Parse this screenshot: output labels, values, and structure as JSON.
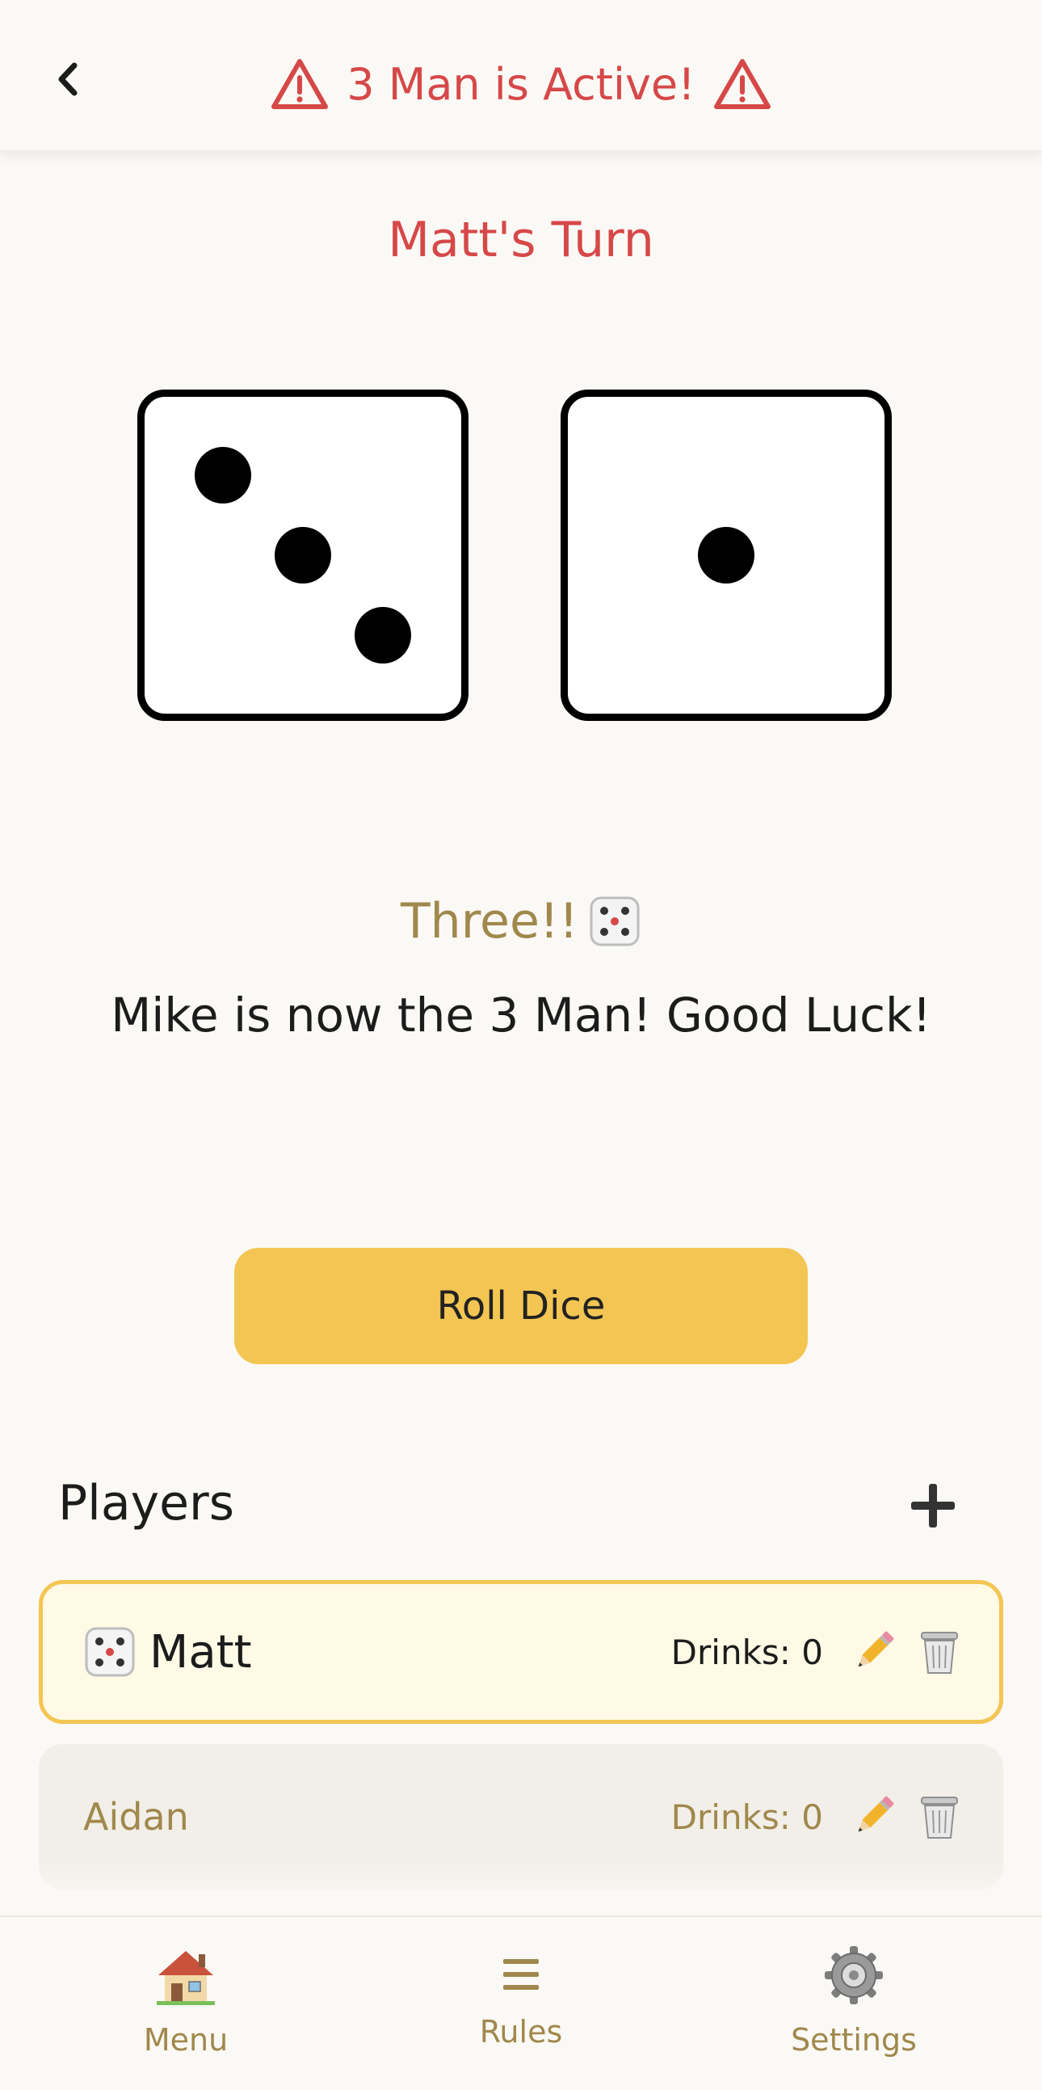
{
  "header": {
    "title": "3 Man is Active!",
    "back_icon": "chevron-left-icon",
    "warning_icon": "warning-triangle-icon",
    "warning_color": "#d64848"
  },
  "turn": {
    "label": "Matt's Turn"
  },
  "dice": {
    "values": [
      3,
      1
    ]
  },
  "result": {
    "title": "Three!!",
    "icon": "dice-icon",
    "message": "Mike is now the 3 Man! Good Luck!"
  },
  "roll_button": {
    "label": "Roll Dice",
    "color": "#f3c552"
  },
  "players_section": {
    "heading": "Players",
    "add_icon": "plus-icon",
    "players": [
      {
        "name": "Matt",
        "drinks_label": "Drinks: 0",
        "active": true
      },
      {
        "name": "Aidan",
        "drinks_label": "Drinks: 0",
        "active": false
      }
    ]
  },
  "tabbar": {
    "items": [
      {
        "label": "Menu",
        "icon": "house-icon"
      },
      {
        "label": "Rules",
        "icon": "list-icon"
      },
      {
        "label": "Settings",
        "icon": "gear-icon"
      }
    ]
  },
  "colors": {
    "accent_red": "#d64848",
    "accent_gold": "#a0884c",
    "background": "#fbf9f5"
  }
}
